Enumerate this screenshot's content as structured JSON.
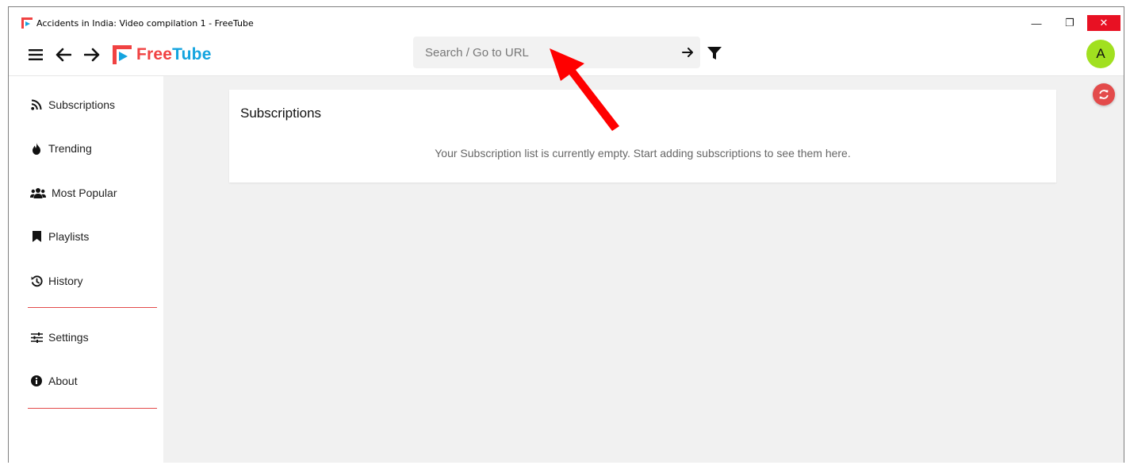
{
  "window": {
    "title": "Accidents in India: Video compilation 1 - FreeTube",
    "min_glyph": "—",
    "max_glyph": "❐",
    "close_glyph": "✕"
  },
  "logo": {
    "free": "Free",
    "tube": "Tube"
  },
  "search": {
    "placeholder": "Search / Go to URL",
    "value": ""
  },
  "avatar": {
    "letter": "A"
  },
  "sidebar": {
    "items": [
      {
        "label": "Subscriptions",
        "icon": "rss-icon"
      },
      {
        "label": "Trending",
        "icon": "fire-icon"
      },
      {
        "label": "Most Popular",
        "icon": "users-icon"
      },
      {
        "label": "Playlists",
        "icon": "bookmark-icon"
      },
      {
        "label": "History",
        "icon": "history-icon"
      },
      {
        "label": "Settings",
        "icon": "sliders-icon"
      },
      {
        "label": "About",
        "icon": "info-icon"
      }
    ]
  },
  "main": {
    "card_title": "Subscriptions",
    "empty_message": "Your Subscription list is currently empty. Start adding subscriptions to see them here."
  },
  "colors": {
    "brand_red": "#f04242",
    "brand_blue": "#14a4df",
    "accent_red": "#e34b4b",
    "avatar_green": "#a1e020",
    "window_close": "#e81123",
    "annotation_arrow": "#ff0000"
  }
}
